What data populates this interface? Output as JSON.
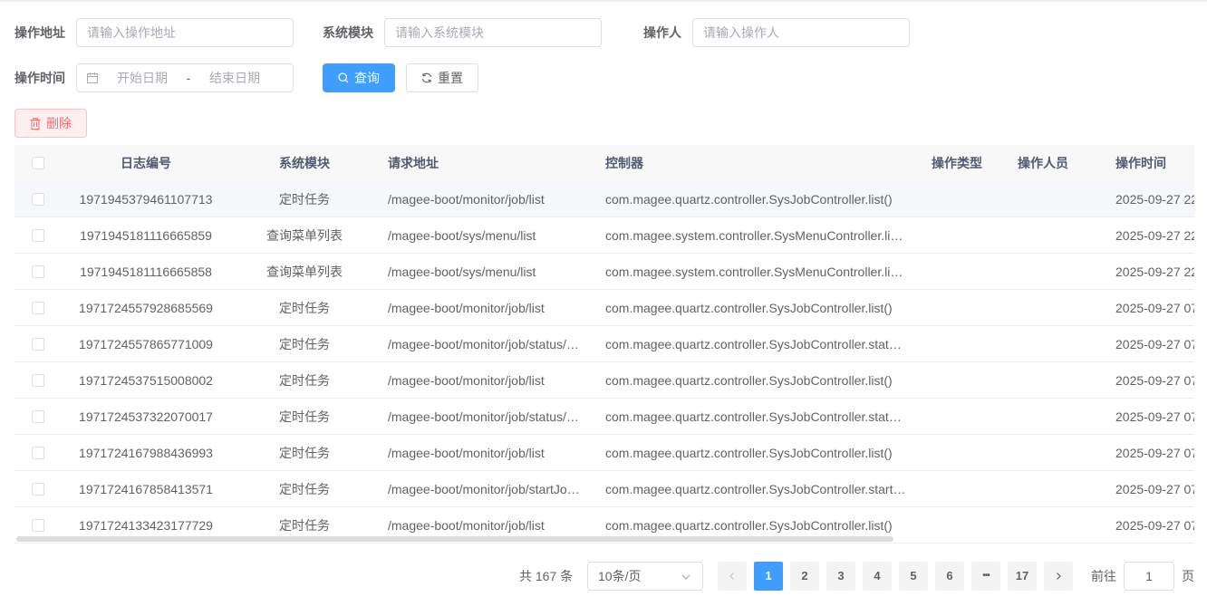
{
  "filters": {
    "address": {
      "label": "操作地址",
      "placeholder": "请输入操作地址"
    },
    "module": {
      "label": "系统模块",
      "placeholder": "请输入系统模块"
    },
    "operator": {
      "label": "操作人",
      "placeholder": "请输入操作人"
    },
    "time": {
      "label": "操作时间",
      "start_placeholder": "开始日期",
      "separator": "-",
      "end_placeholder": "结束日期"
    }
  },
  "buttons": {
    "search": "查询",
    "reset": "重置",
    "delete": "删除"
  },
  "table": {
    "columns": [
      "日志编号",
      "系统模块",
      "请求地址",
      "控制器",
      "操作类型",
      "操作人员",
      "操作时间"
    ],
    "rows": [
      {
        "id": "1971945379461107713",
        "module": "定时任务",
        "url": "/magee-boot/monitor/job/list",
        "controller": "com.magee.quartz.controller.SysJobController.list()",
        "type": "",
        "user": "",
        "time": "2025-09-27 22"
      },
      {
        "id": "1971945181116665859",
        "module": "查询菜单列表",
        "url": "/magee-boot/sys/menu/list",
        "controller": "com.magee.system.controller.SysMenuController.li…",
        "type": "",
        "user": "",
        "time": "2025-09-27 22"
      },
      {
        "id": "1971945181116665858",
        "module": "查询菜单列表",
        "url": "/magee-boot/sys/menu/list",
        "controller": "com.magee.system.controller.SysMenuController.li…",
        "type": "",
        "user": "",
        "time": "2025-09-27 22"
      },
      {
        "id": "1971724557928685569",
        "module": "定时任务",
        "url": "/magee-boot/monitor/job/list",
        "controller": "com.magee.quartz.controller.SysJobController.list()",
        "type": "",
        "user": "",
        "time": "2025-09-27 07"
      },
      {
        "id": "1971724557865771009",
        "module": "定时任务",
        "url": "/magee-boot/monitor/job/status/…",
        "controller": "com.magee.quartz.controller.SysJobController.stat…",
        "type": "",
        "user": "",
        "time": "2025-09-27 07"
      },
      {
        "id": "1971724537515008002",
        "module": "定时任务",
        "url": "/magee-boot/monitor/job/list",
        "controller": "com.magee.quartz.controller.SysJobController.list()",
        "type": "",
        "user": "",
        "time": "2025-09-27 07"
      },
      {
        "id": "1971724537322070017",
        "module": "定时任务",
        "url": "/magee-boot/monitor/job/status/…",
        "controller": "com.magee.quartz.controller.SysJobController.stat…",
        "type": "",
        "user": "",
        "time": "2025-09-27 07"
      },
      {
        "id": "1971724167988436993",
        "module": "定时任务",
        "url": "/magee-boot/monitor/job/list",
        "controller": "com.magee.quartz.controller.SysJobController.list()",
        "type": "",
        "user": "",
        "time": "2025-09-27 07"
      },
      {
        "id": "1971724167858413571",
        "module": "定时任务",
        "url": "/magee-boot/monitor/job/startJo…",
        "controller": "com.magee.quartz.controller.SysJobController.start…",
        "type": "",
        "user": "",
        "time": "2025-09-27 07"
      },
      {
        "id": "1971724133423177729",
        "module": "定时任务",
        "url": "/magee-boot/monitor/job/list",
        "controller": "com.magee.quartz.controller.SysJobController.list()",
        "type": "",
        "user": "",
        "time": "2025-09-27 07"
      }
    ]
  },
  "pagination": {
    "total": "共 167 条",
    "page_size": "10条/页",
    "pages": [
      "1",
      "2",
      "3",
      "4",
      "5",
      "6",
      "•••",
      "17"
    ],
    "current": "1",
    "goto_label": "前往",
    "goto_value": "1",
    "goto_suffix": "页"
  },
  "colors": {
    "primary": "#409eff",
    "danger": "#f56c6c",
    "header_bg": "#f8f8f9"
  }
}
